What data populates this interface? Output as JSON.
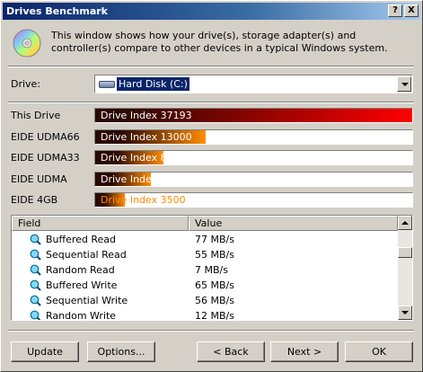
{
  "window": {
    "title": "Drives Benchmark",
    "help_glyph": "?",
    "close_glyph": "X"
  },
  "intro_text": "This window shows how your drive(s), storage adapter(s) and controller(s) compare to other devices in a typical Windows system.",
  "drive": {
    "label": "Drive:",
    "selected": "Hard Disk (C:)"
  },
  "benchmarks": [
    {
      "label": "This Drive",
      "text": "Drive Index 37193",
      "index": 37193,
      "fill_color": "#ff0000",
      "text_color": "#ffffff"
    },
    {
      "label": "EIDE UDMA66",
      "text": "Drive Index 13000",
      "index": 13000,
      "fill_color": "#ff8c00",
      "text_color": "#ffffff"
    },
    {
      "label": "EIDE UDMA33",
      "text": "Drive Index 8000",
      "index": 8000,
      "fill_color": "#ff8c00",
      "text_color": "#ffffff"
    },
    {
      "label": "EIDE UDMA",
      "text": "Drive Index 6500",
      "index": 6500,
      "fill_color": "#ff8c00",
      "text_color": "#ffffff"
    },
    {
      "label": "EIDE 4GB",
      "text": "Drive Index 3500",
      "index": 3500,
      "fill_color": "#ff8c00",
      "text_color": "#ff8c00"
    }
  ],
  "benchmark_max": 37193,
  "list": {
    "columns": [
      "Field",
      "Value"
    ],
    "rows": [
      {
        "field": "Buffered Read",
        "value": "77 MB/s"
      },
      {
        "field": "Sequential Read",
        "value": "55 MB/s"
      },
      {
        "field": "Random Read",
        "value": "7 MB/s"
      },
      {
        "field": "Buffered Write",
        "value": "65 MB/s"
      },
      {
        "field": "Sequential Write",
        "value": "56 MB/s"
      },
      {
        "field": "Random Write",
        "value": "12 MB/s"
      }
    ]
  },
  "buttons": {
    "update": "Update",
    "options": "Options...",
    "back": "< Back",
    "next": "Next >",
    "ok": "OK"
  }
}
